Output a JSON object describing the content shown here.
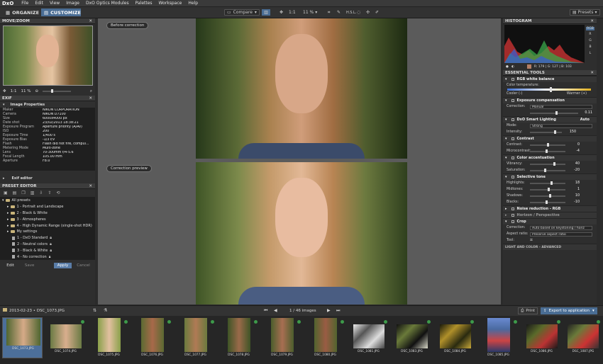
{
  "menu": {
    "logo": "DxO",
    "items": [
      "File",
      "Edit",
      "View",
      "Image",
      "DxO Optics Modules",
      "Palettes",
      "Workspace",
      "Help"
    ]
  },
  "toolbar": {
    "organize": "ORGANIZE",
    "customize": "CUSTOMIZE",
    "compare": "Compare",
    "zoom_1to1": "1:1",
    "zoom_pct": "11 %",
    "presets": "Presets",
    "hsl": "H.S.L."
  },
  "move_zoom": {
    "title": "MOVE/ZOOM",
    "one": "1:1",
    "pct": "11 %"
  },
  "exif": {
    "title": "EXIF",
    "subtitle": "Image Properties",
    "rows": [
      {
        "k": "Maker",
        "v": "NIKON CORPORATION"
      },
      {
        "k": "Camera",
        "v": "NIKON D7100"
      },
      {
        "k": "Size",
        "v": "6000x4000 px"
      },
      {
        "k": "Date shot",
        "v": "23/02/2013 18:38:21"
      },
      {
        "k": "Exposure Program",
        "v": "Aperture priority (A/Av)"
      },
      {
        "k": "ISO",
        "v": "200"
      },
      {
        "k": "Exposure Time",
        "v": "1/400 s"
      },
      {
        "k": "Exposure Bias",
        "v": "-1/3 EV"
      },
      {
        "k": "Flash",
        "v": "Flash did not fire, compul..."
      },
      {
        "k": "Metering Mode",
        "v": "Multi-zone"
      },
      {
        "k": "Lens",
        "v": "70-300mm f/4-5.6"
      },
      {
        "k": "Focal Length",
        "v": "105.00 mm"
      },
      {
        "k": "Aperture",
        "v": "F8.0"
      }
    ]
  },
  "exif_editor": "Exif editor",
  "preset_editor": {
    "title": "PRESET EDITOR",
    "root": "All presets",
    "items": [
      "1 - Portrait and Landscape",
      "2 - Black & White",
      "3 - Atmospheres",
      "4 - High Dynamic Range (single-shot HDR)",
      "My settings"
    ],
    "docs": [
      "1 - DxO Standard",
      "2 - Neutral colors",
      "3 - Black & White",
      "4 - No correction"
    ],
    "edit": "Edit",
    "save": "Save",
    "apply": "Apply",
    "cancel": "Cancel"
  },
  "viewer": {
    "before": "Before correction",
    "after": "Correction preview"
  },
  "histogram": {
    "title": "HISTOGRAM",
    "channels": [
      "RGB",
      "R",
      "G",
      "B",
      "L"
    ],
    "readout": "R: 179 | G: 127 | B: 103"
  },
  "essential": {
    "title": "ESSENTIAL TOOLS",
    "wb": {
      "title": "RGB white balance",
      "temp": "Color temperature:",
      "cooler": "Cooler (-)",
      "warmer": "Warmer (+)"
    },
    "exposure": {
      "title": "Exposure compensation",
      "corr_label": "Correction:",
      "corr": "Manual",
      "value": "0.11"
    },
    "smart": {
      "title": "DxO Smart Lighting",
      "auto": "Auto",
      "mode_label": "Mode:",
      "mode": "Strong",
      "int_label": "Intensity:",
      "intensity": "150"
    },
    "contrast": {
      "title": "Contrast",
      "c_label": "Contrast:",
      "c": "0",
      "m_label": "Microcontrast:",
      "m": "-4"
    },
    "color": {
      "title": "Color accentuation",
      "v_label": "Vibrancy:",
      "v": "40",
      "s_label": "Saturation:",
      "s": "-20"
    },
    "tone": {
      "title": "Selective tone",
      "h_label": "Highlights:",
      "h": "18",
      "m_label": "Midtones:",
      "m": "1",
      "sh_label": "Shadows:",
      "sh": "10",
      "b_label": "Blacks:",
      "b": "-10"
    },
    "noise": "Noise reduction - RGB",
    "horizon": "Horizon / Perspective",
    "crop": {
      "title": "Crop",
      "corr_label": "Correction:",
      "corr": "Auto based on keystoning / horiz",
      "ar_label": "Aspect ratio:",
      "ar": "Preserve aspect ratio",
      "tool_label": "Tool:"
    },
    "more": "LIGHT AND COLOR - ADVANCED"
  },
  "film": {
    "path": "2013-02-23 • DSC_1073.JPG",
    "counter": "1 / 46",
    "images": "images",
    "print": "Print",
    "export": "Export to application",
    "thumbs": [
      "DSC_1073.JPG",
      "DSC_1074.JPG",
      "DSC_1075.JPG",
      "DSC_1076.JPG",
      "DSC_1077.JPG",
      "DSC_1078.JPG",
      "DSC_1079.JPG",
      "DSC_1080.JPG",
      "DSC_1081.JPG",
      "DSC_1083.JPG",
      "DSC_1084.JPG",
      "DSC_1085.JPG",
      "DSC_1086.JPG",
      "DSC_1087.JPG"
    ]
  }
}
